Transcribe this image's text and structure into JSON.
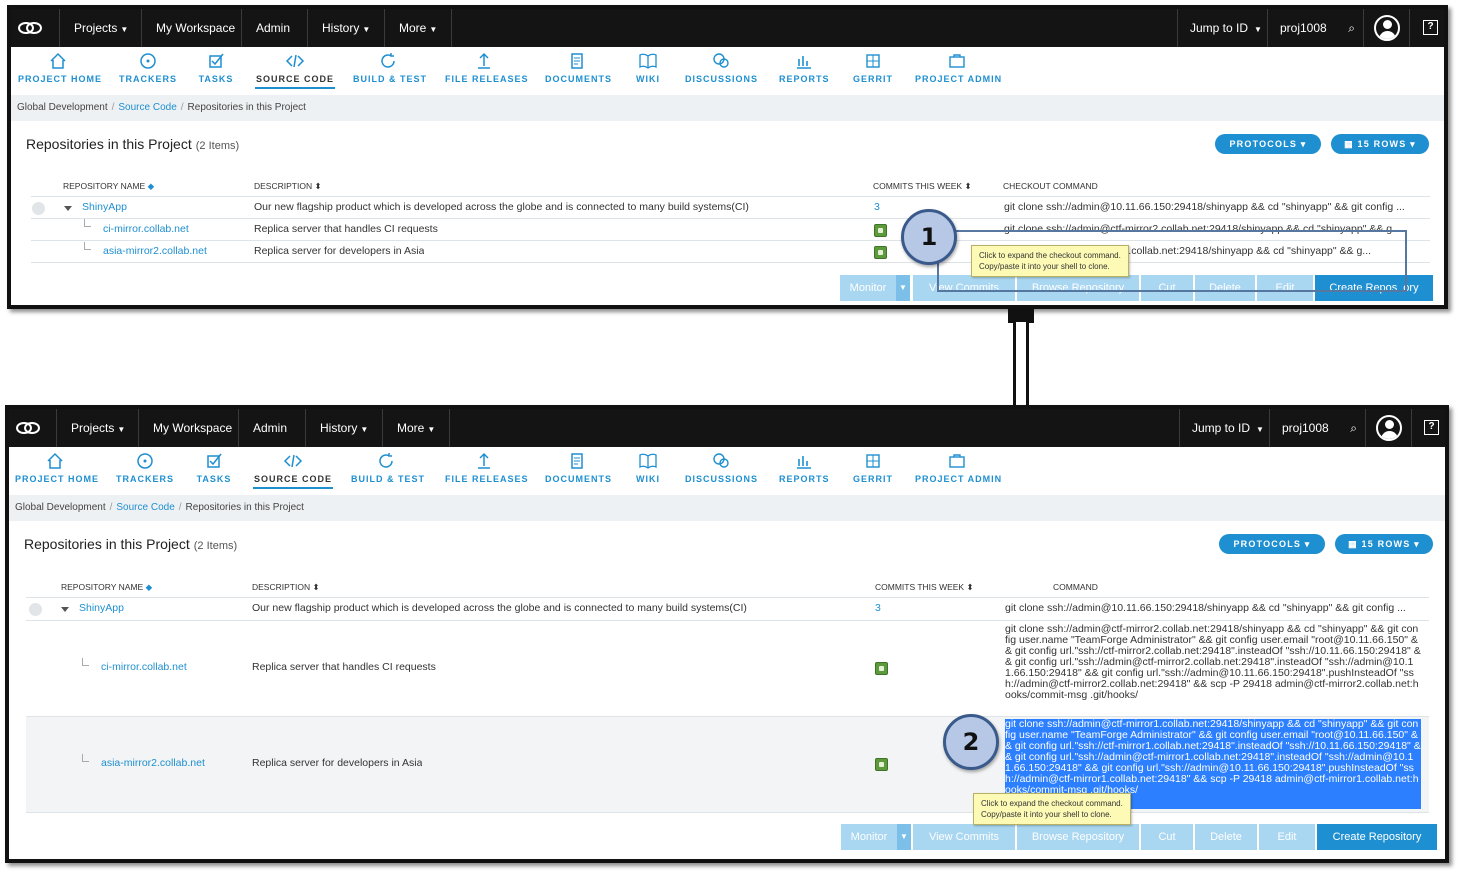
{
  "topnav": {
    "projects": "Projects",
    "my_workspace": "My Workspace",
    "admin": "Admin",
    "history": "History",
    "more": "More",
    "jump_to_id": "Jump to ID",
    "project_id": "proj1008"
  },
  "tools": [
    {
      "label": "PROJECT HOME",
      "icon": "home-icon"
    },
    {
      "label": "TRACKERS",
      "icon": "target-icon"
    },
    {
      "label": "TASKS",
      "icon": "checkbox-icon"
    },
    {
      "label": "SOURCE CODE",
      "icon": "code-icon"
    },
    {
      "label": "BUILD & TEST",
      "icon": "refresh-icon"
    },
    {
      "label": "FILE RELEASES",
      "icon": "upload-icon"
    },
    {
      "label": "DOCUMENTS",
      "icon": "document-icon"
    },
    {
      "label": "WIKI",
      "icon": "book-icon"
    },
    {
      "label": "DISCUSSIONS",
      "icon": "chat-icon"
    },
    {
      "label": "REPORTS",
      "icon": "chart-icon"
    },
    {
      "label": "GERRIT",
      "icon": "grid-icon"
    },
    {
      "label": "PROJECT ADMIN",
      "icon": "briefcase-icon"
    }
  ],
  "breadcrumb": {
    "root": "Global Development",
    "section": "Source Code",
    "current": "Repositories in this Project",
    "sep": "/"
  },
  "page": {
    "title": "Repositories in this Project",
    "count": "(2 Items)",
    "protocols": "PROTOCOLS",
    "rows_per_page": "15 ROWS"
  },
  "columns": {
    "name": "REPOSITORY NAME",
    "description": "DESCRIPTION",
    "commits": "COMMITS THIS WEEK",
    "checkout": "CHECKOUT COMMAND",
    "checkout_partial": "COMMAND"
  },
  "rows": [
    {
      "name": "ShinyApp",
      "description": "Our new flagship product which is developed across the globe and is connected to many build systems(CI)",
      "commits": "3",
      "checkout": "git clone ssh://admin@10.11.66.150:29418/shinyapp && cd \"shinyapp\" && git config ...",
      "checkout_partial": "git clone ssh://admin@10.11.66.150:29418/shinyapp && cd \"shinyapp\" && git config ..."
    },
    {
      "name": "ci-mirror.collab.net",
      "description": "Replica server that handles CI requests",
      "checkout": "git clone ssh://admin@ctf-mirror2.collab.net:29418/shinyapp && cd \"shinyapp\" && g...",
      "checkout_full": "git clone ssh://admin@ctf-mirror2.collab.net:29418/shinyapp && cd \"shinyapp\" && git config user.name \"TeamForge Administrator\" && git config user.email \"root@10.11.66.150\" && git config url.\"ssh://ctf-mirror2.collab.net:29418\".insteadOf \"ssh://10.11.66.150:29418\" && git config url.\"ssh://admin@ctf-mirror2.collab.net:29418\".insteadOf \"ssh://admin@10.11.66.150:29418\" && git config url.\"ssh://admin@10.11.66.150:29418\".pushInsteadOf \"ssh://admin@ctf-mirror2.collab.net:29418\" && scp -P 29418 admin@ctf-mirror2.collab.net:hooks/commit-msg .git/hooks/"
    },
    {
      "name": "asia-mirror2.collab.net",
      "description": "Replica server for developers in Asia",
      "checkout": "r1.collab.net:29418/shinyapp && cd \"shinyapp\" && g...",
      "checkout_full": "git clone ssh://admin@ctf-mirror1.collab.net:29418/shinyapp && cd \"shinyapp\" && git config user.name \"TeamForge Administrator\" && git config user.email \"root@10.11.66.150\" && git config url.\"ssh://ctf-mirror1.collab.net:29418\".insteadOf \"ssh://10.11.66.150:29418\" && git config url.\"ssh://admin@ctf-mirror1.collab.net:29418\".insteadOf \"ssh://admin@10.11.66.150:29418\" && git config url.\"ssh://admin@10.11.66.150:29418\".pushInsteadOf \"ssh://admin@ctf-mirror1.collab.net:29418\" && scp -P 29418 admin@ctf-mirror1.collab.net:hooks/commit-msg .git/hooks/"
    }
  ],
  "tooltip": {
    "line1": "Click to expand the checkout command.",
    "line2": "Copy/paste it into your shell to clone."
  },
  "buttons": {
    "monitor": "Monitor",
    "view_commits": "View Commits",
    "view_commits_partial": "View Commits",
    "browse": "Browse Repository",
    "cut": "Cut",
    "delete": "Delete",
    "edit": "Edit",
    "create": "Create Repository",
    "create_partial": "Create Repos",
    "create_partial_end": "ory"
  },
  "callouts": {
    "step1": "1",
    "step2": "2"
  },
  "colors": {
    "accent": "#1e8fd0",
    "topbar": "#141414",
    "selection": "#2c7fff",
    "tooltip": "#fdfab6"
  }
}
